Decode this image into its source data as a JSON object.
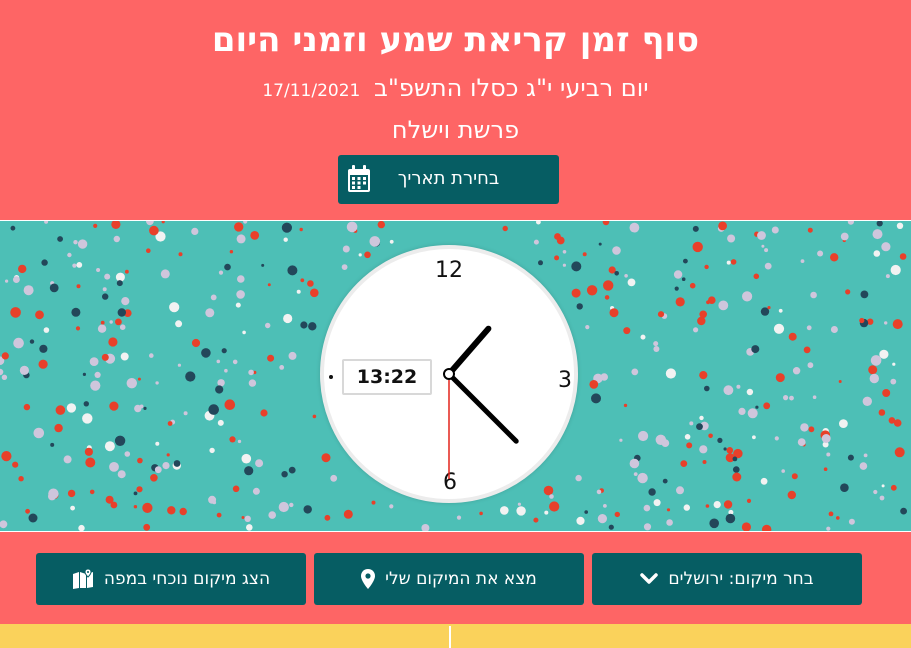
{
  "header": {
    "title": "סוף זמן קריאת שמע וזמני היום",
    "hebrew_date": "יום רביעי י\"ג כסלו התשפ\"ב",
    "gregorian_date": "17/11/2021",
    "parasha": "פרשת וישלח",
    "date_button_label": "בחירת תאריך",
    "date_button_icon": "calendar-icon"
  },
  "clock": {
    "digital_time": "13:22",
    "numeral_12": "12",
    "numeral_3": "3",
    "numeral_6": "6",
    "hour": 13,
    "minute": 22,
    "second": 30
  },
  "controls": {
    "location_select_label": "בחר מיקום: ירושלים",
    "location_select_icon": "chevron-down-icon",
    "find_location_label": "מצא את המיקום שלי",
    "find_location_icon": "map-pin-icon",
    "show_map_label": "הצג מיקום נוכחי במפה",
    "show_map_icon": "map-icon"
  },
  "colors": {
    "header_bg": "#fe6565",
    "button_bg": "#065d63",
    "hero_bg": "#4dbfb6",
    "bottom_strip": "#fad25b"
  }
}
